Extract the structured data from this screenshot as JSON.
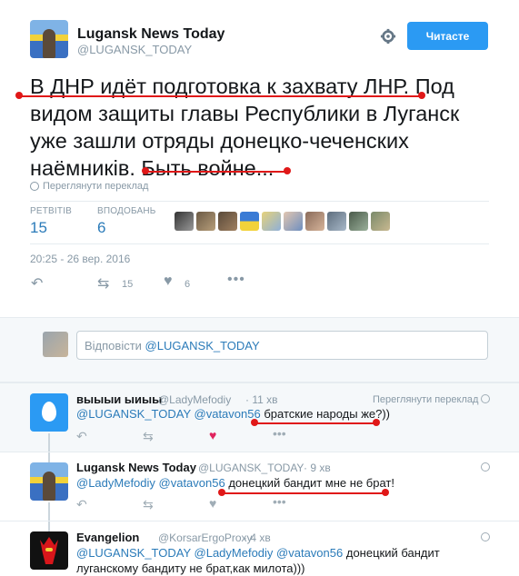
{
  "tweet": {
    "author_name": "Lugansk News Today",
    "author_handle": "@LUGANSK_TODAY",
    "follow_label": "Читасте",
    "text_line1": "В ДНР идёт подготовка к захвату ЛНР. Под",
    "text_line2": "видом защиты главы Республики в Луганск",
    "text_line3": "уже зашли отряды донецко-чеченских",
    "text_line4": "наёмників. Быть войне...",
    "translate_label": "Переглянути переклад",
    "retweets_label": "РЕТВІТІВ",
    "retweets_count": "15",
    "likes_label": "ВПОДОБАНЬ",
    "likes_count": "6",
    "timestamp": "20:25 - 26 вер. 2016",
    "action_retweet_count": "15",
    "action_like_count": "6"
  },
  "reply_box": {
    "prefix": "Відповісти ",
    "mention": "@LUGANSK_TODAY"
  },
  "replies": [
    {
      "name": "выыыи ыиыы",
      "handle": "@LadyMefodiy",
      "time": "· 11 хв",
      "translate": "Переглянути переклад",
      "mentions": "@LUGANSK_TODAY @vatavon56",
      "text": "братские народы же?))"
    },
    {
      "name": "Lugansk News Today",
      "handle": "@LUGANSK_TODAY",
      "time": "· 9 хв",
      "mentions": "@LadyMefodiy @vatavon56",
      "text": "донецкий бандит мне не брат!"
    },
    {
      "name": "Evangelion",
      "handle": "@KorsarErgoProxy",
      "time": "· 4 хв",
      "mentions": "@LUGANSK_TODAY @LadyMefodiy @vatavon56",
      "text": "донецкий бандит",
      "text_line2": "луганскому бандиту не брат,как милота)))"
    }
  ],
  "colors": {
    "accent": "#2b9af3",
    "link": "#2b7bb9",
    "annotation_red": "#e01818",
    "like_red": "#e0245e"
  }
}
